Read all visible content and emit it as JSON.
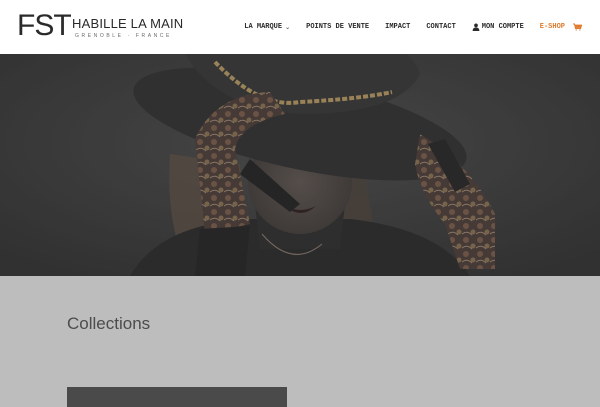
{
  "logo": {
    "brand": "FST",
    "tagline": "HABILLE LA MAIN",
    "location": "GRENOBLE · FRANCE"
  },
  "nav": {
    "items": [
      {
        "label": "LA MARQUE",
        "has_dropdown": true
      },
      {
        "label": "POINTS DE VENTE"
      },
      {
        "label": "IMPACT"
      },
      {
        "label": "CONTACT"
      },
      {
        "label": "MON COMPTE",
        "icon": "user-icon"
      },
      {
        "label": "E-SHOP",
        "color": "#e07a2e"
      }
    ],
    "cart_icon": "cart-icon"
  },
  "hero": {
    "image_subject": "woman in wide-brim black hat with gold chain, wearing patterned gloves"
  },
  "collections": {
    "title": "Collections"
  },
  "colors": {
    "accent": "#e07a2e",
    "header_bg": "#ffffff",
    "section_bg": "#bdbdbd",
    "hero_overlay": "#3a3a3a"
  }
}
